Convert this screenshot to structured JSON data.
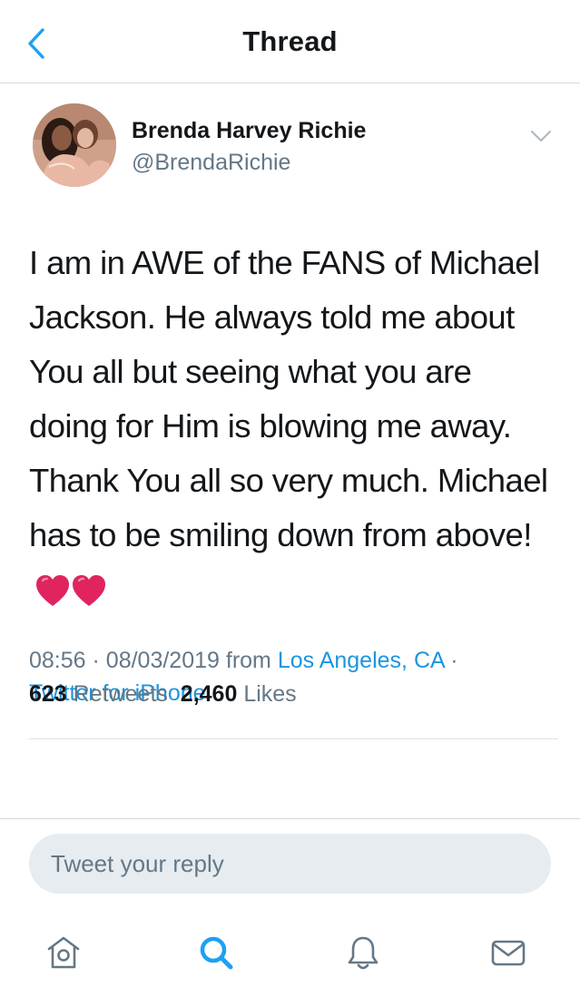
{
  "header": {
    "title": "Thread",
    "back_icon": "chevron-left-icon"
  },
  "tweet": {
    "author_name": "Brenda Harvey Richie",
    "author_handle": "@BrendaRichie",
    "text": "I am in AWE of the FANS of Michael Jackson. He always told me about You all but seeing what you are doing for Him is blowing me away. Thank You all so very much. Michael has to be smiling down from above!",
    "text_emoji": "heart-emoji x2",
    "time": "08:56",
    "date": "08/03/2019",
    "from_label": "from",
    "location": "Los Angeles, CA",
    "separator": "·",
    "source": "Twitter for iPhone",
    "retweet_count": "623",
    "retweet_label": "Retweets",
    "like_count": "2,460",
    "like_label": "Likes"
  },
  "reply": {
    "placeholder": "Tweet your reply"
  },
  "tab_bar": {
    "items": [
      {
        "icon": "home-icon",
        "active": false
      },
      {
        "icon": "search-icon",
        "active": true
      },
      {
        "icon": "bell-icon",
        "active": false
      },
      {
        "icon": "envelope-icon",
        "active": false
      }
    ]
  },
  "colors": {
    "accent": "#1da1f2",
    "link": "#1b95e0",
    "secondary_text": "#657786",
    "primary_text": "#14171a",
    "heart": "#e0245e"
  }
}
